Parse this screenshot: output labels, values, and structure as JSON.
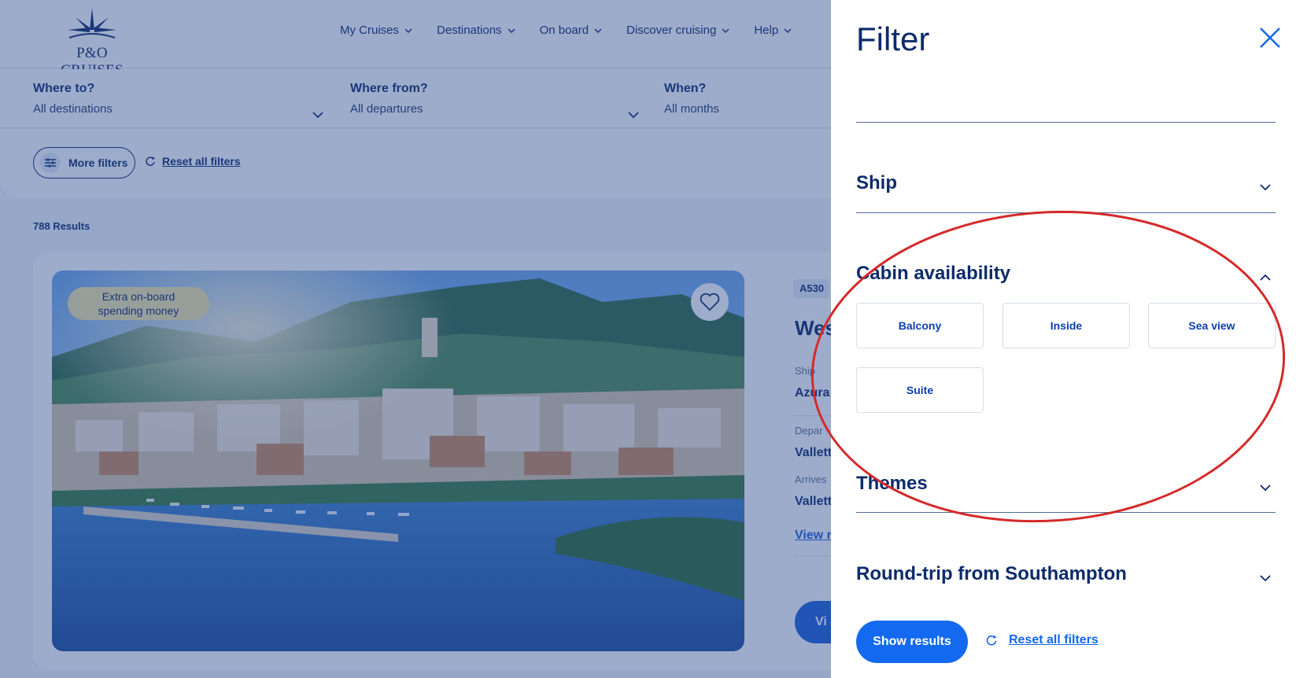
{
  "brand": {
    "logo_text": "P&O CRUISES"
  },
  "nav": [
    {
      "label": "My Cruises"
    },
    {
      "label": "Destinations"
    },
    {
      "label": "On board"
    },
    {
      "label": "Discover cruising"
    },
    {
      "label": "Help"
    }
  ],
  "search": {
    "where_to": {
      "label": "Where to?",
      "value": "All destinations"
    },
    "where_from": {
      "label": "Where from?",
      "value": "All departures"
    },
    "when": {
      "label": "When?",
      "value": "All months"
    }
  },
  "filters_bar": {
    "more_filters": "More filters",
    "reset": "Reset all filters"
  },
  "results": {
    "count": "788 Results"
  },
  "card": {
    "badge_line1": "Extra on-board",
    "badge_line2": "spending money",
    "code": "A530",
    "title": "Wes",
    "ship_label": "Ship",
    "ship_value": "Azura",
    "departs_label": "Depar",
    "departs_value": "Vallett",
    "arrives_label": "Arrives",
    "arrives_value": "Vallett",
    "view_link": "View r",
    "view_button": "Vi"
  },
  "panel": {
    "title": "Filter",
    "sections": [
      {
        "title": "Ship",
        "expanded": false
      },
      {
        "title": "Cabin availability",
        "expanded": true,
        "options": [
          "Balcony",
          "Inside",
          "Sea view",
          "Suite"
        ]
      },
      {
        "title": "Themes",
        "expanded": false
      },
      {
        "title": "Round-trip from Southampton",
        "expanded": false
      }
    ],
    "show_results": "Show results",
    "reset": "Reset all filters"
  },
  "colors": {
    "navy": "#0d2b6b",
    "accent_blue": "#1369f0",
    "annotation_red": "#d42a2a",
    "badge_yellow": "#f5e8a6"
  }
}
